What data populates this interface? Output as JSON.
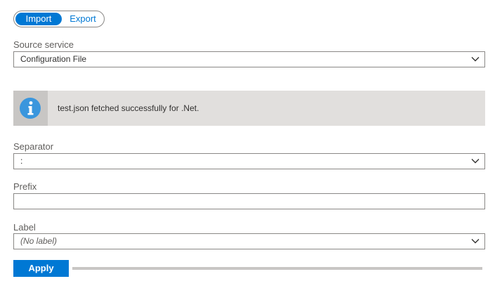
{
  "mode_toggle": {
    "import_label": "Import",
    "export_label": "Export",
    "selected": "Import"
  },
  "source_service": {
    "label": "Source service",
    "value": "Configuration File"
  },
  "info_message": {
    "text": "test.json fetched successfully for .Net."
  },
  "separator": {
    "label": "Separator",
    "value": ":"
  },
  "prefix": {
    "label": "Prefix",
    "value": ""
  },
  "label_field": {
    "label": "Label",
    "placeholder": "(No label)"
  },
  "actions": {
    "apply_label": "Apply"
  },
  "icons": {
    "dropdown": "chevron-down-icon",
    "info": "info-icon"
  },
  "colors": {
    "accent": "#0078d4",
    "info_icon": "#3a96dd"
  }
}
